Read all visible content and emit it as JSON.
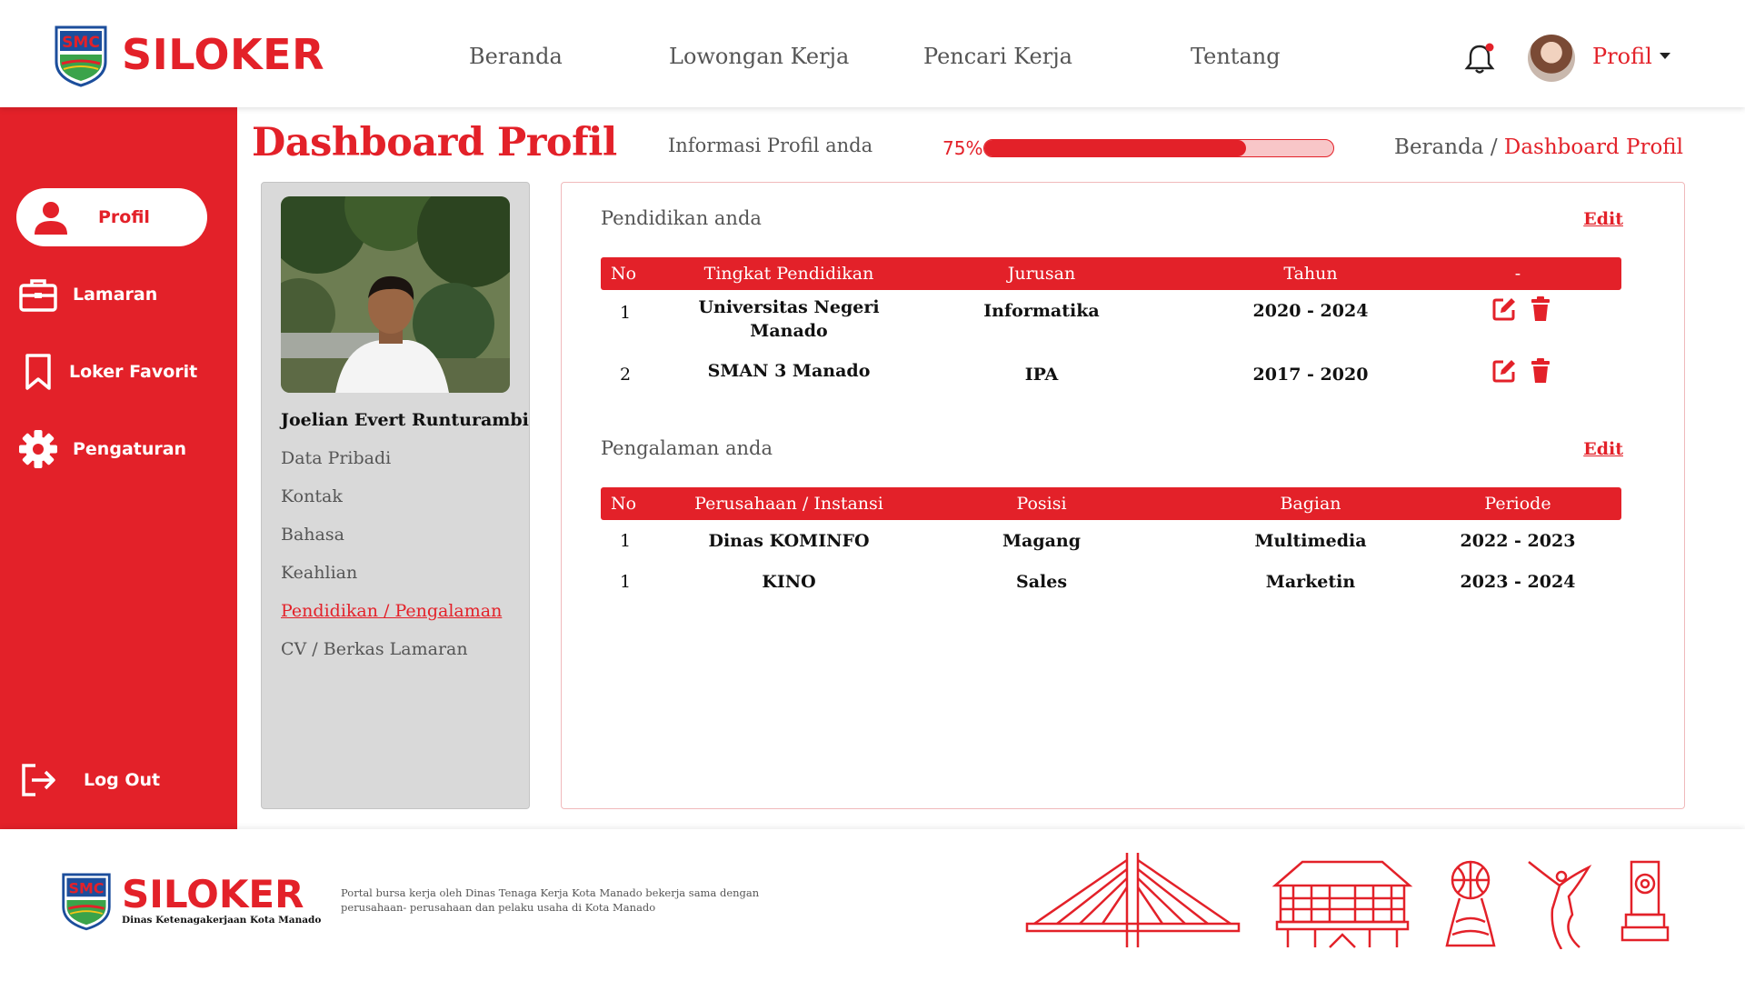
{
  "app": {
    "name": "SILOKER"
  },
  "nav": {
    "items": [
      {
        "label": "Beranda"
      },
      {
        "label": "Lowongan Kerja"
      },
      {
        "label": "Pencari Kerja"
      },
      {
        "label": "Tentang"
      }
    ],
    "profile_label": "Profil"
  },
  "sidebar": {
    "items": [
      {
        "label": "Profil",
        "icon": "user-icon",
        "active": true
      },
      {
        "label": "Lamaran",
        "icon": "briefcase-icon"
      },
      {
        "label": "Loker Favorit",
        "icon": "bookmark-icon"
      },
      {
        "label": "Pengaturan",
        "icon": "gear-icon"
      }
    ],
    "logout_label": "Log Out"
  },
  "page": {
    "title": "Dashboard Profil",
    "profile_info_label": "Informasi Profil anda",
    "progress_label": "75%",
    "progress_value": 0.75,
    "breadcrumb": {
      "home": "Beranda",
      "separator": "/",
      "current": "Dashboard Profil"
    }
  },
  "profile": {
    "name": "Joelian Evert Runturambi",
    "menu": [
      {
        "label": "Data Pribadi"
      },
      {
        "label": "Kontak"
      },
      {
        "label": "Bahasa"
      },
      {
        "label": "Keahlian"
      },
      {
        "label": "Pendidikan / Pengalaman",
        "active": true
      },
      {
        "label": "CV / Berkas Lamaran"
      }
    ]
  },
  "education": {
    "title": "Pendidikan anda",
    "edit_label": "Edit",
    "headers": [
      "No",
      "Tingkat Pendidikan",
      "Jurusan",
      "Tahun",
      "-"
    ],
    "rows": [
      {
        "no": "1",
        "institution": "Universitas Negeri Manado",
        "major": "Informatika",
        "years": "2020 - 2024"
      },
      {
        "no": "2",
        "institution": "SMAN 3 Manado",
        "major": "IPA",
        "years": "2017 - 2020"
      }
    ]
  },
  "experience": {
    "title": "Pengalaman anda",
    "edit_label": "Edit",
    "headers": [
      "No",
      "Perusahaan / Instansi",
      "Posisi",
      "Bagian",
      "Periode"
    ],
    "rows": [
      {
        "no": "1",
        "company": "Dinas KOMINFO",
        "position": "Magang",
        "division": "Multimedia",
        "period": "2022 - 2023"
      },
      {
        "no": "1",
        "company": "KINO",
        "position": "Sales",
        "division": "Marketin",
        "period": "2023 - 2024"
      }
    ]
  },
  "footer": {
    "brand": "SILOKER",
    "subtitle": "Dinas Ketenagakerjaan Kota Manado",
    "description": "Portal bursa kerja oleh Dinas Tenaga Kerja Kota Manado bekerja sama dengan perusahaan- perusahaan dan pelaku usaha di Kota Manado"
  },
  "colors": {
    "accent": "#e32129",
    "accent_light": "#f8c6c8",
    "card_grey": "#d9d9d9"
  }
}
